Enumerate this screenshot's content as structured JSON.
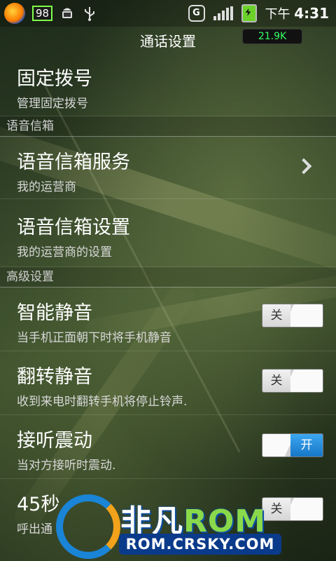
{
  "status_bar": {
    "battery_percent": "98",
    "carrier_type": "G",
    "time_prefix": "下午",
    "time": "4:31",
    "icons": [
      "app-logo-icon",
      "android-debug-icon",
      "usb-icon",
      "gprs-icon",
      "signal-icon",
      "battery-charging-icon"
    ]
  },
  "header": {
    "title": "通话设置",
    "speed": "21.9K"
  },
  "list": {
    "fixed_dial": {
      "title": "固定拨号",
      "subtitle": "管理固定拨号"
    },
    "section_voicemail": "语音信箱",
    "voicemail_service": {
      "title": "语音信箱服务",
      "subtitle": "我的运营商"
    },
    "voicemail_settings": {
      "title": "语音信箱设置",
      "subtitle": "我的运营商的设置"
    },
    "section_advanced": "高级设置",
    "smart_mute": {
      "title": "智能静音",
      "subtitle": "当手机正面朝下时将手机静音",
      "toggle": "关",
      "state": "off"
    },
    "flip_mute": {
      "title": "翻转静音",
      "subtitle": "收到来电时翻转手机将停止铃声.",
      "toggle": "关",
      "state": "off"
    },
    "answer_vibrate": {
      "title": "接听震动",
      "subtitle": "当对方接听时震动.",
      "toggle": "开",
      "state": "on"
    },
    "reminder_45s": {
      "title": "45秒",
      "subtitle": "呼出通",
      "toggle": "关",
      "state": "off"
    }
  },
  "watermark": {
    "brand_cn": "非凡",
    "brand_en": "ROM",
    "url": "ROM.CRSKY.COM"
  },
  "colors": {
    "toggle_on": "#1f87d6",
    "speed_text": "#36ff63",
    "battery_border": "#7fff4a"
  }
}
